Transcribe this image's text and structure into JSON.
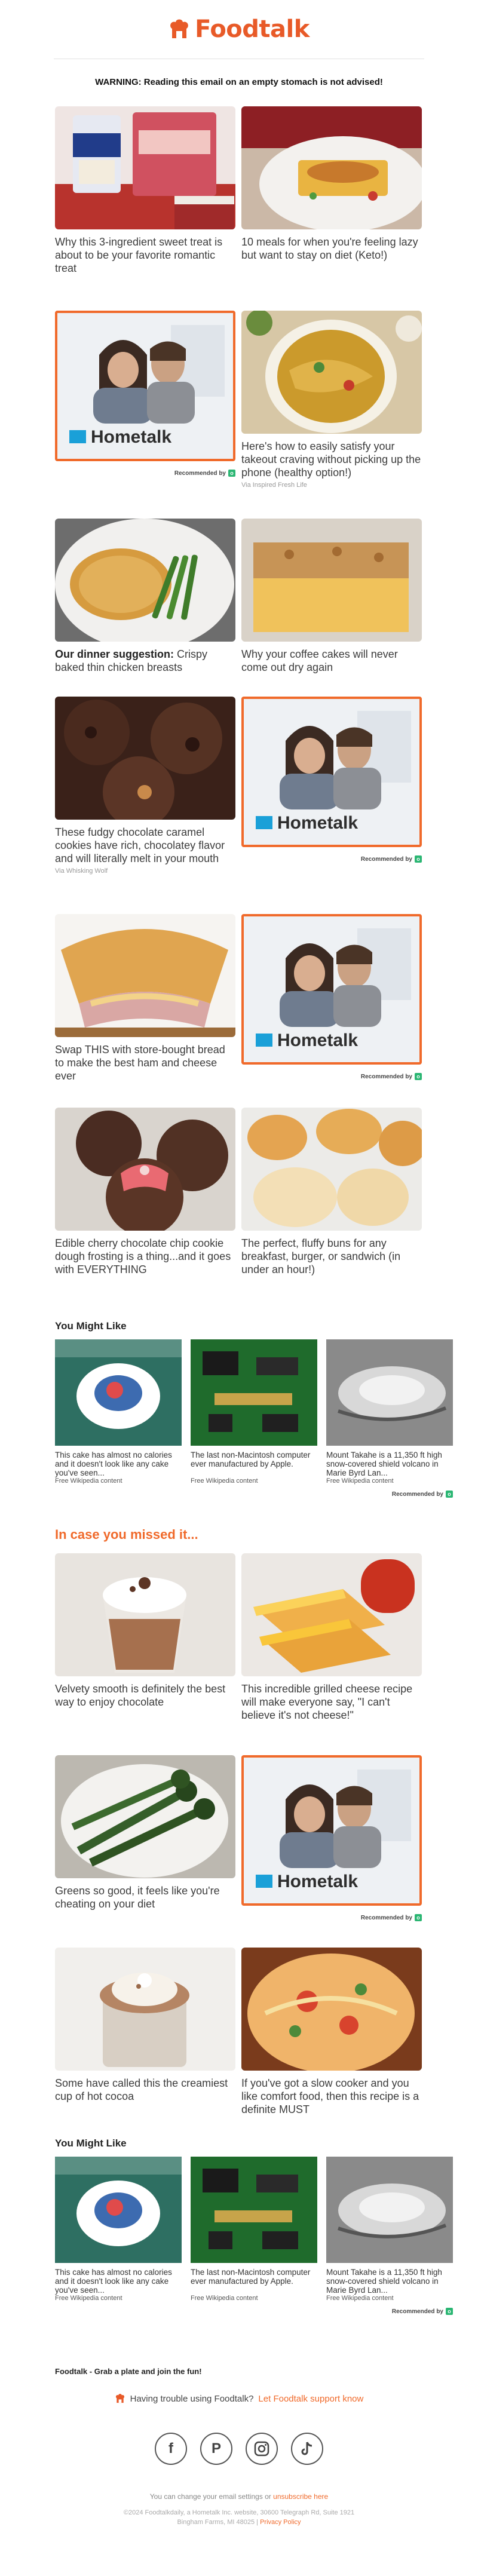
{
  "brand": {
    "name": "Foodtalk",
    "color": "#e85a28"
  },
  "warning": "WARNING: Reading this email on an empty stomach is not advised!",
  "cards": {
    "c1": {
      "caption": "Why this 3-ingredient sweet treat is about to be your favorite romantic treat"
    },
    "c2": {
      "caption": "10 meals for when you're feeling lazy but want to stay on diet (Keto!)"
    },
    "c4": {
      "caption": "Here's how to easily satisfy your takeout craving without picking up the phone (healthy option!)",
      "via": "Via Inspired Fresh Life"
    },
    "c5": {
      "caption_bold": "Our dinner suggestion:",
      "caption": " Crispy baked thin chicken breasts"
    },
    "c6": {
      "caption": "Why your coffee cakes will never come out dry again"
    },
    "c7": {
      "caption": "These fudgy chocolate caramel cookies have rich, chocolatey flavor and will literally melt in your mouth",
      "via": "Via Whisking Wolf"
    },
    "c9": {
      "caption": "Swap THIS with store-bought bread to make the best ham and cheese ever"
    },
    "c11": {
      "caption": "Edible cherry chocolate chip cookie dough frosting is a thing...and it goes with EVERYTHING"
    },
    "c12": {
      "caption": "The perfect, fluffy buns for any breakfast, burger, or sandwich (in under an hour!)"
    },
    "m1": {
      "caption": "Velvety smooth is definitely the best way to enjoy chocolate"
    },
    "m2": {
      "caption": "This incredible grilled cheese recipe will make everyone say, \"I can't believe it's not cheese!\""
    },
    "m3": {
      "caption": "Greens so good, it feels like you're cheating on your diet"
    },
    "m5": {
      "caption": "Some have called this the creamiest cup of hot cocoa"
    },
    "m6": {
      "caption": "If you've got a slow cooker and you like comfort food, then this recipe is a definite MUST"
    }
  },
  "ad": {
    "brand": "Hometalk",
    "recommended": "Recommended by"
  },
  "you_might_like": {
    "title": "You Might Like",
    "items": [
      {
        "text": "This cake has almost no calories and it doesn't look like any cake you've seen...",
        "source": "Free Wikipedia content"
      },
      {
        "text": "The last non-Macintosh computer ever manufactured by Apple.",
        "source": "Free Wikipedia content"
      },
      {
        "text": "Mount Takahe is a 11,350 ft high snow-covered shield volcano in Marie Byrd Lan...",
        "source": "Free Wikipedia content"
      }
    ],
    "recommended": "Recommended by"
  },
  "missed_title": "In case you missed it...",
  "tagline": "Foodtalk - Grab a plate and join the fun!",
  "trouble": {
    "text": "Having trouble using Foodtalk?",
    "link": "Let Foodtalk support know"
  },
  "socials": [
    "facebook-icon",
    "pinterest-icon",
    "instagram-icon",
    "tiktok-icon"
  ],
  "footer": {
    "settings_text": "You can change your email settings or",
    "unsubscribe": "unsubscribe here",
    "legal": "©2024 Foodtalkdaily, a Hometalk Inc. website, 30600 Telegraph Rd, Suite 1921",
    "address": "Bingham Farms, MI 48025",
    "privacy": "Privacy Policy"
  }
}
